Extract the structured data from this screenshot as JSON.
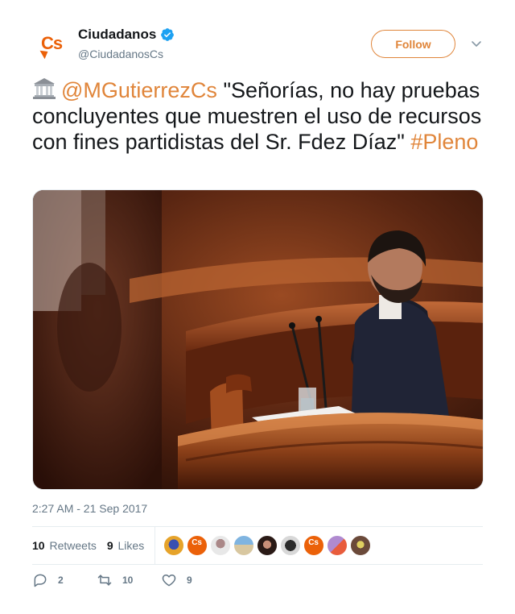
{
  "author": {
    "display_name": "Ciudadanos",
    "handle": "@CiudadanosCs",
    "verified": true,
    "avatar_text": "Cs"
  },
  "follow_label": "Follow",
  "tweet": {
    "emoji": "classical-building-icon",
    "mention": "@MGutierrezCs",
    "text": " \"Señorías, no hay pruebas concluyentes que muestren el uso de recursos con fines partidistas del Sr. Fdez Díaz\" ",
    "hashtag": "#Pleno"
  },
  "timestamp": "2:27 AM - 21 Sep 2017",
  "stats": {
    "retweets_count": "10",
    "retweets_label": "Retweets",
    "likes_count": "9",
    "likes_label": "Likes"
  },
  "actions": {
    "reply_count": "2",
    "retweet_count": "10",
    "like_count": "9"
  },
  "colors": {
    "accent": "#e0853a",
    "brand": "#eb6109",
    "verified": "#1da1f2",
    "muted": "#657786"
  }
}
